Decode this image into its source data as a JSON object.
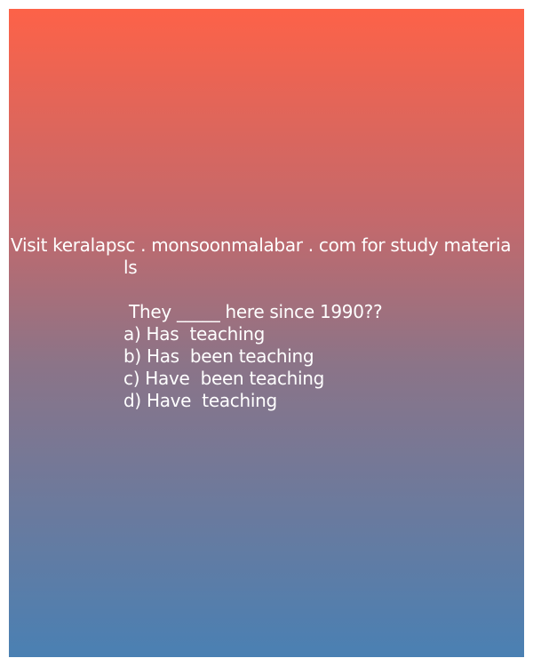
{
  "promo": {
    "line1": "Visit keralapsc . monsoonmalabar . com for study materia",
    "line2": "ls"
  },
  "question": {
    "text": " They _____ here since 1990??",
    "options": [
      "a) Has  teaching",
      "b) Has  been teaching",
      "c) Have  been teaching",
      "d) Have  teaching"
    ]
  },
  "colors": {
    "top": "#fd6248",
    "bottom": "#4a80b3",
    "text": "#ffffff"
  }
}
